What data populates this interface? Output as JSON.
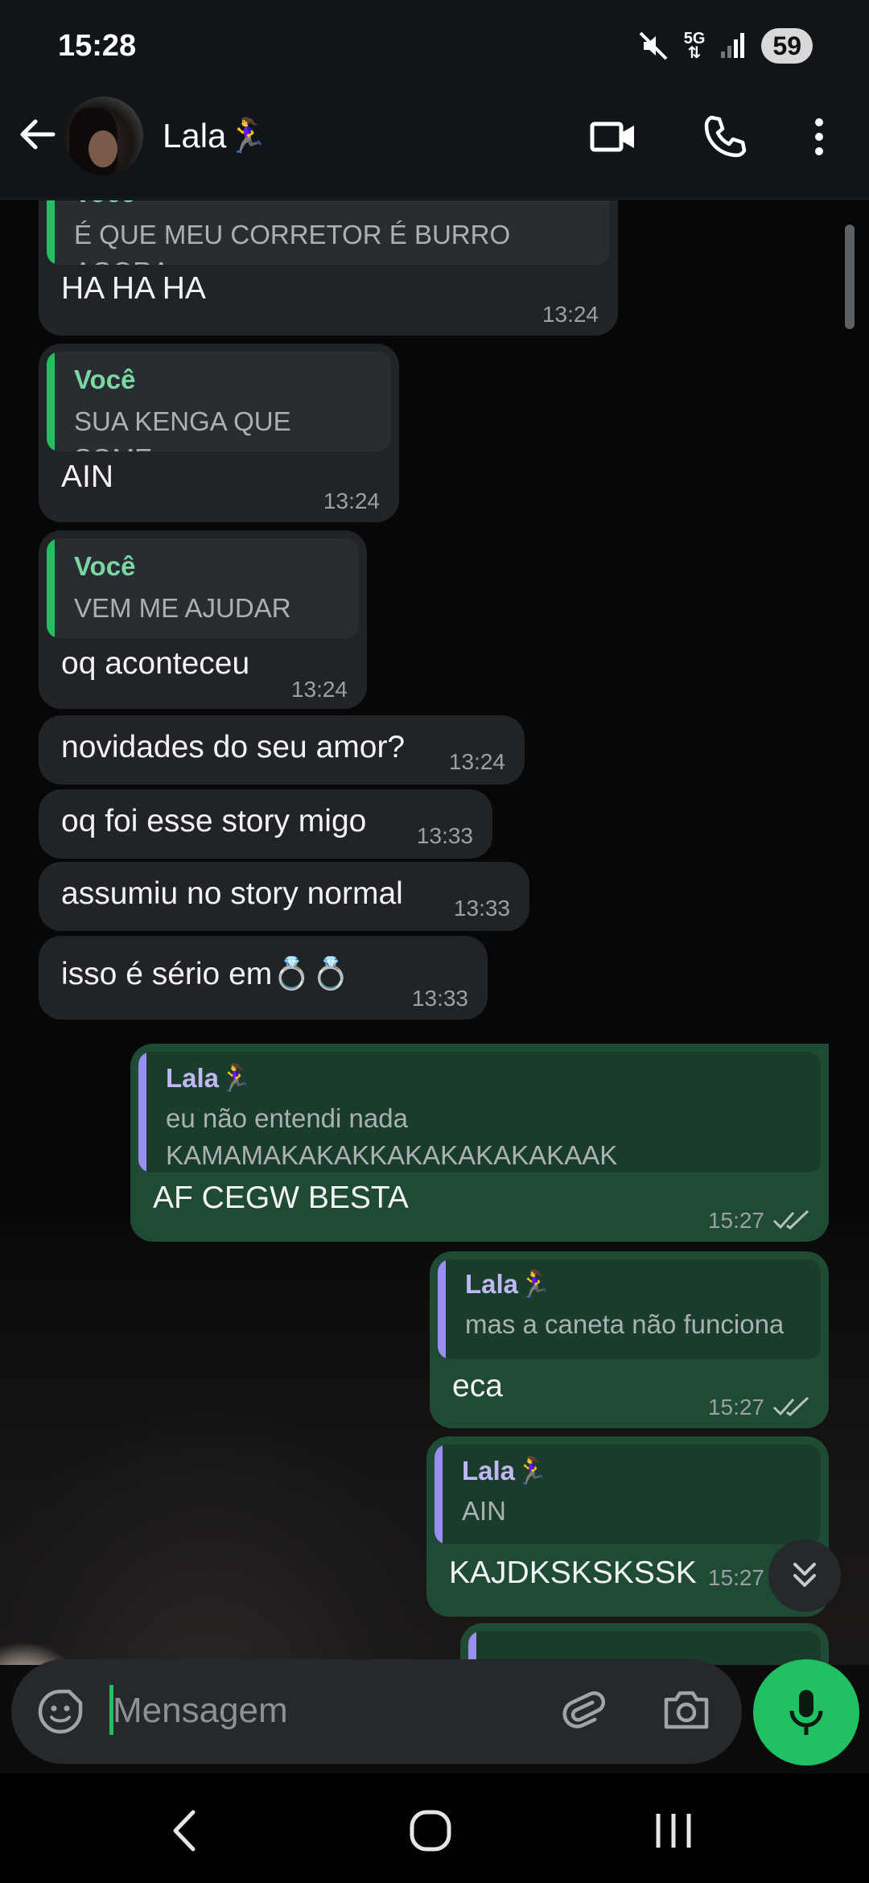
{
  "status_bar": {
    "time": "15:28",
    "network": "5G",
    "battery": "59",
    "icons": [
      "mute-icon",
      "network-icon",
      "signal-icon",
      "battery-badge"
    ]
  },
  "header": {
    "contact_name": "Lala🏃‍♀️",
    "icons": [
      "back-arrow-icon",
      "avatar",
      "video-call-icon",
      "voice-call-icon",
      "more-options-icon"
    ]
  },
  "messages": [
    {
      "direction": "in",
      "quote_author": "Você",
      "quote_text": "É QUE MEU CORRETOR É BURRO AGORA",
      "text": "HA HA HA",
      "time": "13:24"
    },
    {
      "direction": "in",
      "quote_author": "Você",
      "quote_text": "SUA KENGA QUE SOME",
      "text": "AIN",
      "time": "13:24"
    },
    {
      "direction": "in",
      "quote_author": "Você",
      "quote_text": "VEM ME AJUDAR",
      "text": "oq aconteceu",
      "time": "13:24"
    },
    {
      "direction": "in",
      "text": "novidades do seu amor?",
      "time": "13:24"
    },
    {
      "direction": "in",
      "text": "oq foi esse story migo",
      "time": "13:33"
    },
    {
      "direction": "in",
      "text": "assumiu no story normal",
      "time": "13:33"
    },
    {
      "direction": "in",
      "text": "isso é sério em💍💍",
      "time": "13:33"
    },
    {
      "direction": "out",
      "quote_author": "Lala🏃‍♀️",
      "quote_text": "eu não entendi nada KAMAMAKAKAKKAKAKAKAKAKAAK",
      "text": "AF CEGW BESTA",
      "time": "15:27",
      "status": "read"
    },
    {
      "direction": "out",
      "quote_author": "Lala🏃‍♀️",
      "quote_text": "mas a caneta não funciona",
      "text": "eca",
      "time": "15:27",
      "status": "read"
    },
    {
      "direction": "out",
      "quote_author": "Lala🏃‍♀️",
      "quote_text": "AIN",
      "text": "KAJDKSKSKSSK",
      "time": "15:27",
      "status": "read"
    }
  ],
  "composer": {
    "placeholder": "Mensagem",
    "icons": [
      "sticker-icon",
      "attach-icon",
      "camera-icon",
      "microphone-icon"
    ]
  },
  "navigation": {
    "buttons": [
      "back-nav",
      "home-nav",
      "recents-nav"
    ]
  },
  "colors": {
    "accent": "#21c063",
    "incoming_bubble": "#202427",
    "outgoing_bubble": "#1f4a34",
    "outgoing_quote_bar": "#9a8ef0"
  }
}
